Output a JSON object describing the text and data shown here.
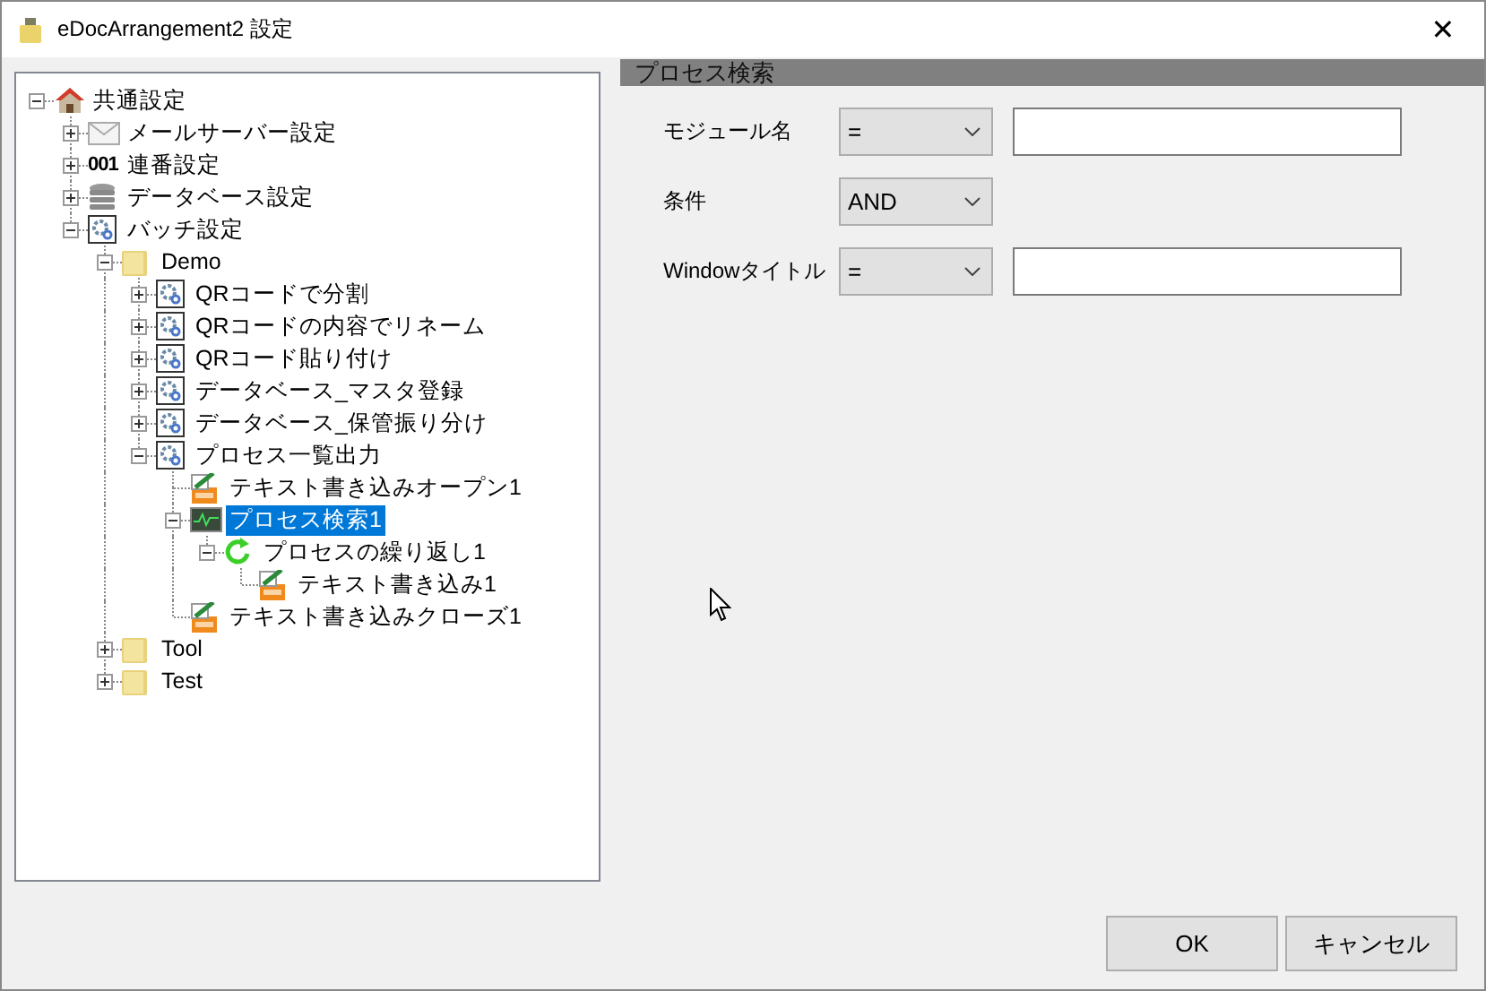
{
  "window": {
    "title": "eDocArrangement2 設定",
    "close": "✕"
  },
  "tree": [
    {
      "label": "共通設定",
      "kind": "home",
      "expanded": true,
      "selected": false,
      "children": [
        {
          "label": "メールサーバー設定",
          "kind": "mail",
          "expanded": false,
          "selected": false
        },
        {
          "label": "連番設定",
          "kind": "counter",
          "icon_text": "001",
          "expanded": false,
          "selected": false
        },
        {
          "label": "データベース設定",
          "kind": "database",
          "expanded": false,
          "selected": false
        },
        {
          "label": "バッチ設定",
          "kind": "batch",
          "expanded": true,
          "selected": false,
          "children": [
            {
              "label": "Demo",
              "kind": "folder",
              "expanded": true,
              "selected": false,
              "children": [
                {
                  "label": "QRコードで分割",
                  "kind": "batch",
                  "expanded": false,
                  "selected": false
                },
                {
                  "label": "QRコードの内容でリネーム",
                  "kind": "batch",
                  "expanded": false,
                  "selected": false
                },
                {
                  "label": "QRコード貼り付け",
                  "kind": "batch",
                  "expanded": false,
                  "selected": false
                },
                {
                  "label": "データベース_マスタ登録",
                  "kind": "batch",
                  "expanded": false,
                  "selected": false
                },
                {
                  "label": "データベース_保管振り分け",
                  "kind": "batch",
                  "expanded": false,
                  "selected": false
                },
                {
                  "label": "プロセス一覧出力",
                  "kind": "batch",
                  "expanded": true,
                  "selected": false,
                  "children": [
                    {
                      "label": "テキスト書き込みオープン1",
                      "kind": "text",
                      "selected": false
                    },
                    {
                      "label": "プロセス検索1",
                      "kind": "process",
                      "expanded": true,
                      "selected": true,
                      "children": [
                        {
                          "label": "プロセスの繰り返し1",
                          "kind": "loop",
                          "expanded": true,
                          "selected": false,
                          "children": [
                            {
                              "label": "テキスト書き込み1",
                              "kind": "text",
                              "selected": false
                            }
                          ]
                        }
                      ]
                    },
                    {
                      "label": "テキスト書き込みクローズ1",
                      "kind": "text",
                      "selected": false
                    }
                  ]
                }
              ]
            },
            {
              "label": "Tool",
              "kind": "folder",
              "expanded": false,
              "selected": false
            },
            {
              "label": "Test",
              "kind": "folder",
              "expanded": false,
              "selected": false
            }
          ]
        }
      ]
    }
  ],
  "panel": {
    "title": "プロセス検索",
    "fields": [
      {
        "kind": "match",
        "label": "モジュール名",
        "operator": "="
      },
      {
        "kind": "logic",
        "label": "条件",
        "operator": "AND"
      },
      {
        "kind": "match",
        "label": "Windowタイトル",
        "operator": "="
      }
    ]
  },
  "buttons": [
    "OK",
    "キャンセル"
  ]
}
